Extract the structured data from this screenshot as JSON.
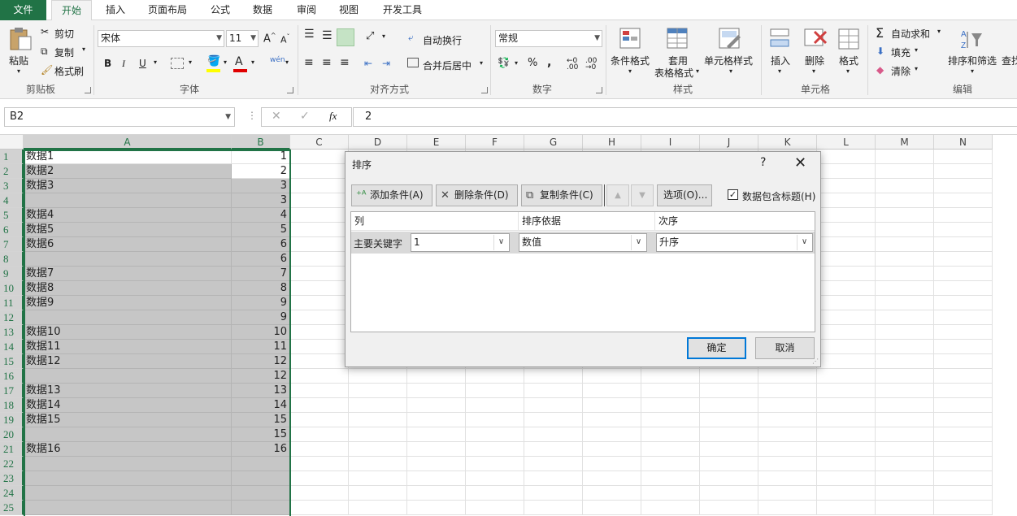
{
  "tabs": [
    "文件",
    "开始",
    "插入",
    "页面布局",
    "公式",
    "数据",
    "审阅",
    "视图",
    "开发工具"
  ],
  "clipboard": {
    "paste": "粘贴",
    "cut": "剪切",
    "copy": "复制",
    "format_painter": "格式刷",
    "label": "剪贴板"
  },
  "font": {
    "name": "宋体",
    "size": "11",
    "bold": "B",
    "italic": "I",
    "underline": "U",
    "wen": "wén",
    "label": "字体"
  },
  "alignment": {
    "wrap": "自动换行",
    "merge": "合并后居中",
    "label": "对齐方式"
  },
  "number": {
    "format": "常规",
    "percent": "%",
    "comma": ",",
    "label": "数字"
  },
  "styles": {
    "conditional": "条件格式",
    "table_line1": "套用",
    "table_line2": "表格格式",
    "cell_styles": "单元格样式",
    "label": "样式"
  },
  "cells": {
    "insert": "插入",
    "delete": "删除",
    "format": "格式",
    "label": "单元格"
  },
  "editing": {
    "autosum": "自动求和",
    "fill": "填充",
    "clear": "清除",
    "sort_filter": "排序和筛选",
    "find": "查找",
    "label": "编辑"
  },
  "formula_bar": {
    "name_box": "B2",
    "fx": "fx",
    "value": "2"
  },
  "columns": [
    "A",
    "B",
    "C",
    "D",
    "E",
    "F",
    "G",
    "H",
    "I",
    "J",
    "K",
    "L",
    "M",
    "N"
  ],
  "rows": [
    {
      "n": "1",
      "a": "数据1",
      "b": "1"
    },
    {
      "n": "2",
      "a": "数据2",
      "b": "2"
    },
    {
      "n": "3",
      "a": "数据3",
      "b": "3"
    },
    {
      "n": "4",
      "a": "",
      "b": "3"
    },
    {
      "n": "5",
      "a": "数据4",
      "b": "4"
    },
    {
      "n": "6",
      "a": "数据5",
      "b": "5"
    },
    {
      "n": "7",
      "a": "数据6",
      "b": "6"
    },
    {
      "n": "8",
      "a": "",
      "b": "6"
    },
    {
      "n": "9",
      "a": "数据7",
      "b": "7"
    },
    {
      "n": "10",
      "a": "数据8",
      "b": "8"
    },
    {
      "n": "11",
      "a": "数据9",
      "b": "9"
    },
    {
      "n": "12",
      "a": "",
      "b": "9"
    },
    {
      "n": "13",
      "a": "数据10",
      "b": "10"
    },
    {
      "n": "14",
      "a": "数据11",
      "b": "11"
    },
    {
      "n": "15",
      "a": "数据12",
      "b": "12"
    },
    {
      "n": "16",
      "a": "",
      "b": "12"
    },
    {
      "n": "17",
      "a": "数据13",
      "b": "13"
    },
    {
      "n": "18",
      "a": "数据14",
      "b": "14"
    },
    {
      "n": "19",
      "a": "数据15",
      "b": "15"
    },
    {
      "n": "20",
      "a": "",
      "b": "15"
    },
    {
      "n": "21",
      "a": "数据16",
      "b": "16"
    },
    {
      "n": "22",
      "a": "",
      "b": ""
    },
    {
      "n": "23",
      "a": "",
      "b": ""
    },
    {
      "n": "24",
      "a": "",
      "b": ""
    },
    {
      "n": "25",
      "a": "",
      "b": ""
    }
  ],
  "dialog": {
    "title": "排序",
    "help": "?",
    "close": "✕",
    "add": "添加条件(A)",
    "delete": "删除条件(D)",
    "copy": "复制条件(C)",
    "options": "选项(O)...",
    "has_header": "数据包含标题(H)",
    "col_header": "列",
    "sort_on_header": "排序依据",
    "order_header": "次序",
    "primary_key": "主要关键字",
    "column_value": "1",
    "sort_on_value": "数值",
    "order_value": "升序",
    "ok": "确定",
    "cancel": "取消"
  }
}
